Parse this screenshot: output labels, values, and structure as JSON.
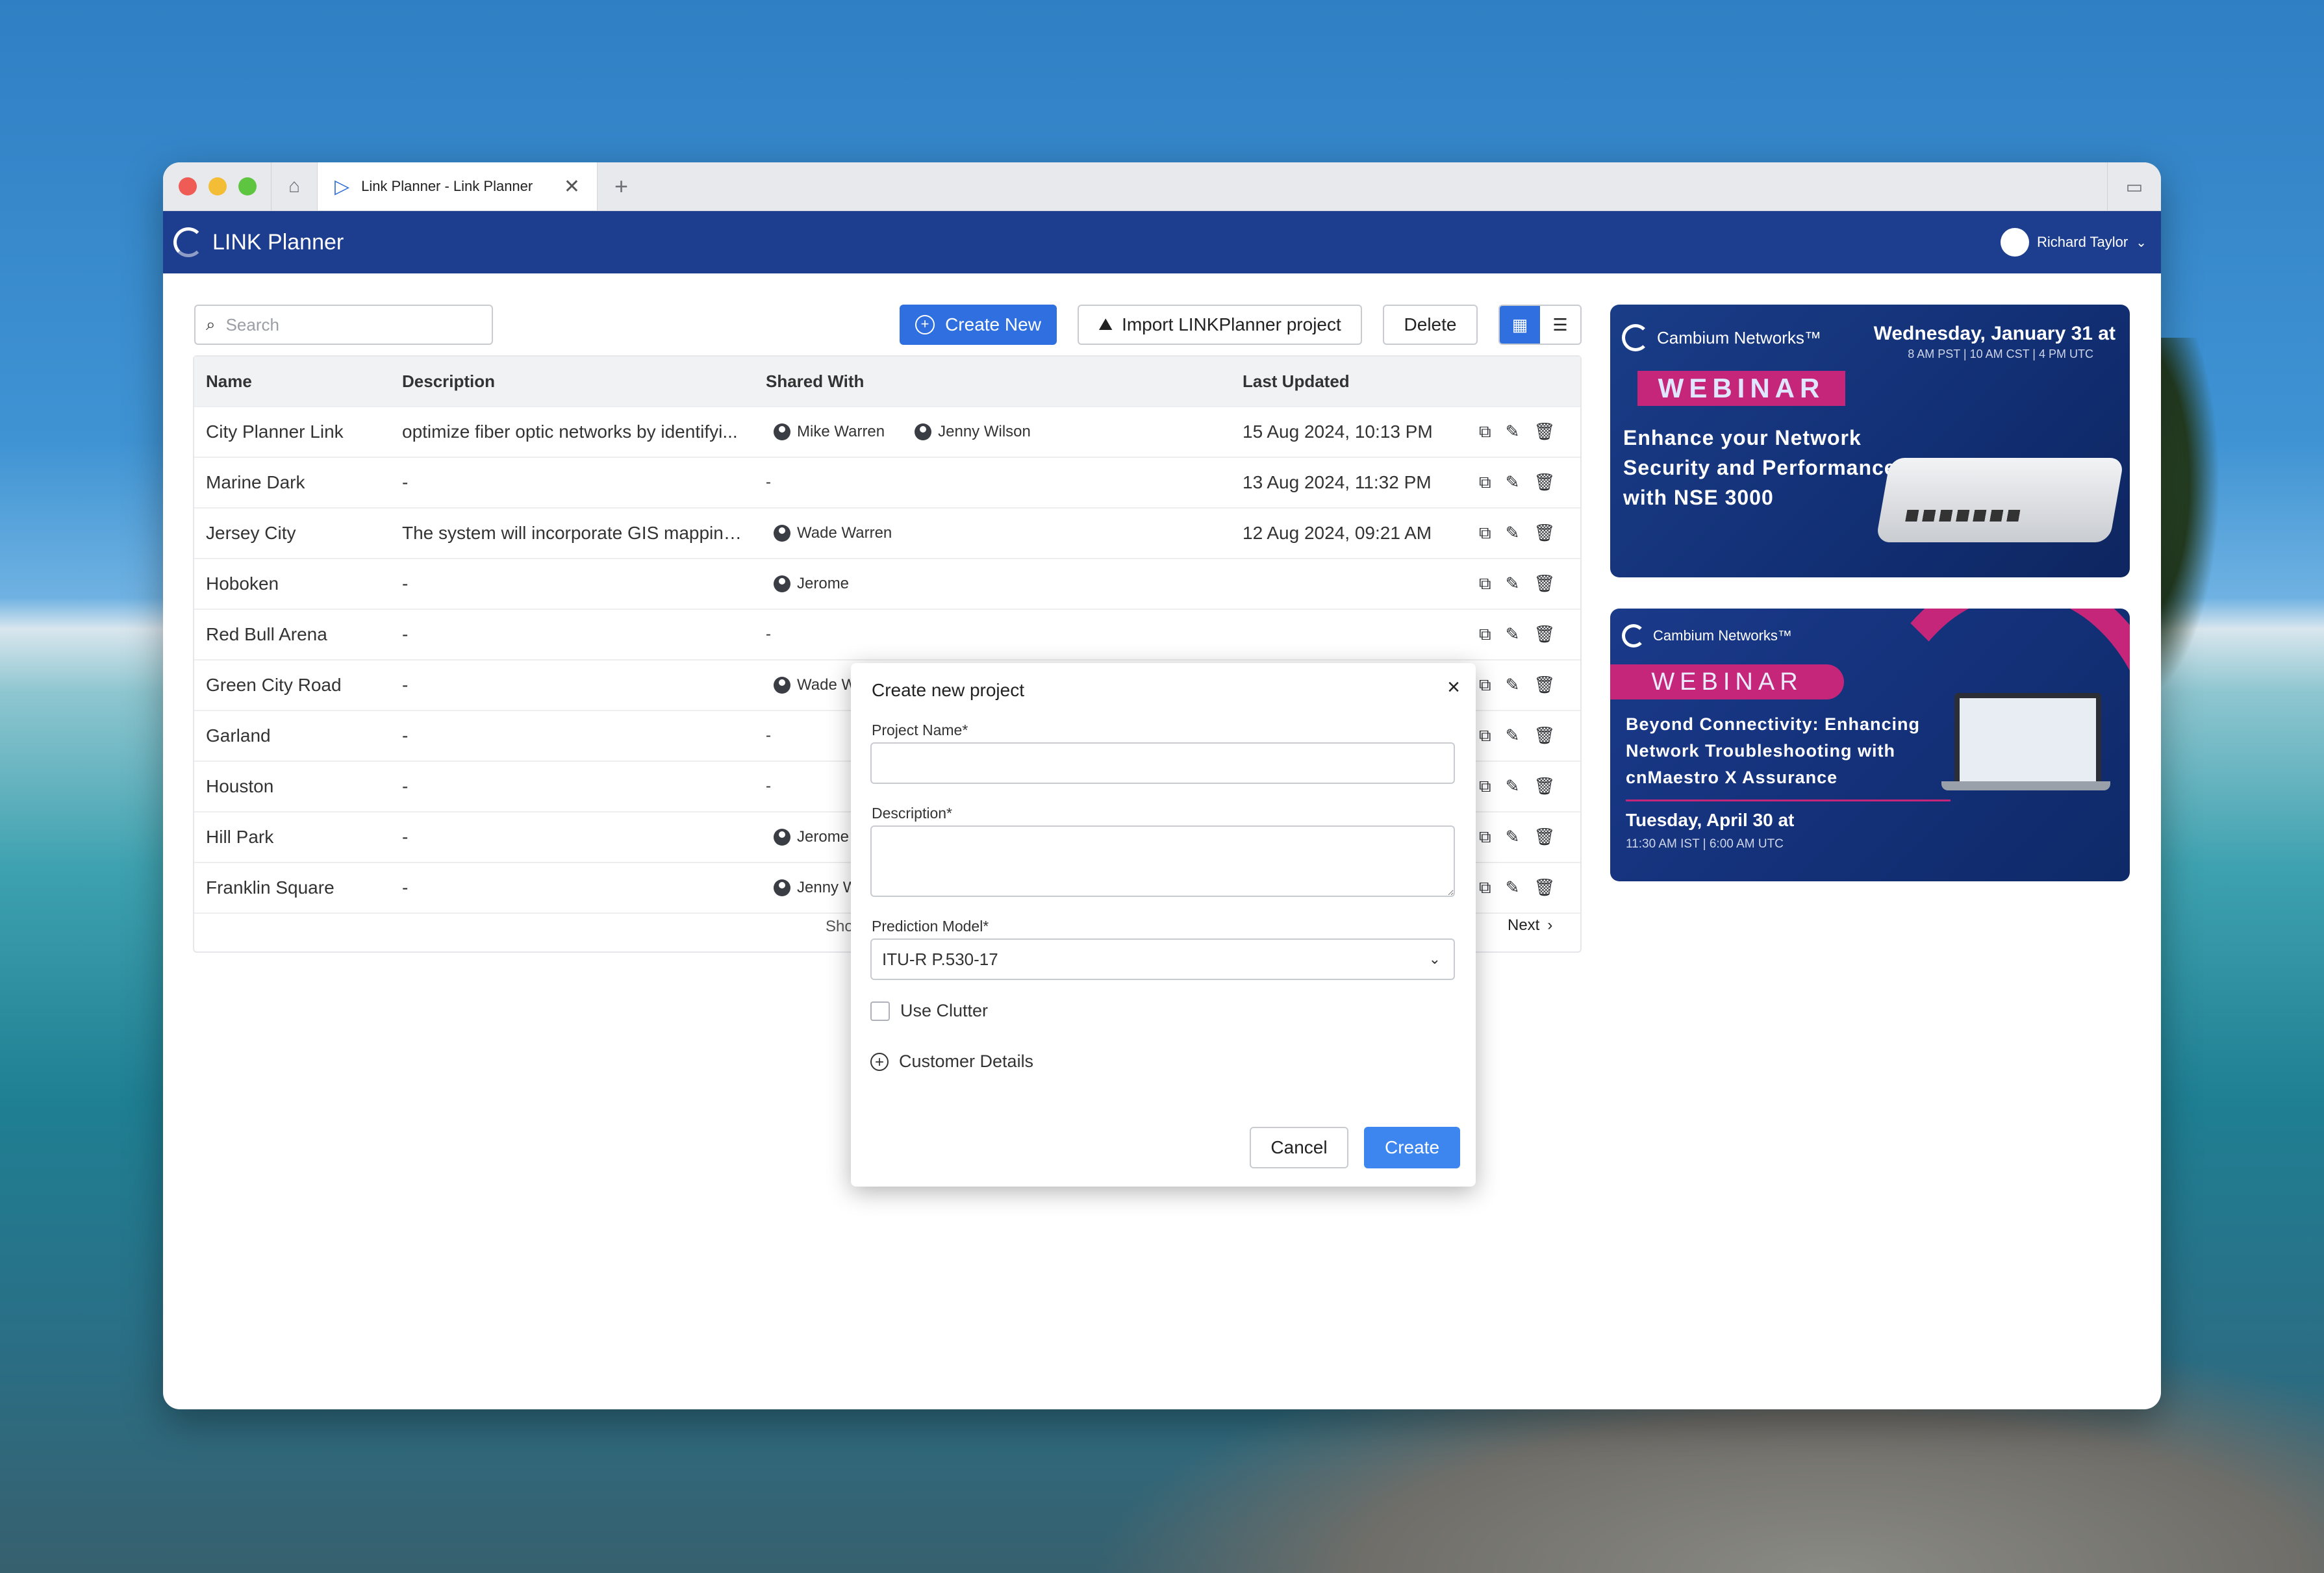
{
  "browser": {
    "tab_title": "Link Planner - Link Planner",
    "home_icon": "home-icon",
    "new_tab_icon": "plus-icon"
  },
  "app": {
    "title": "LINK Planner",
    "user_name": "Richard Taylor"
  },
  "toolbar": {
    "search_placeholder": "Search",
    "create_new_label": "Create New",
    "import_label": "Import LINKPlanner project",
    "delete_label": "Delete"
  },
  "table": {
    "headers": {
      "name": "Name",
      "description": "Description",
      "shared_with": "Shared With",
      "last_updated": "Last Updated"
    },
    "rows": [
      {
        "name": "City Planner Link",
        "description": "optimize fiber optic networks by identifyi...",
        "shared": [
          "Mike Warren",
          "Jenny Wilson"
        ],
        "updated": "15 Aug 2024,  10:13  PM"
      },
      {
        "name": "Marine Dark",
        "description": "-",
        "shared_text": "-",
        "updated": "13 Aug 2024,  11:32  PM"
      },
      {
        "name": "Jersey City",
        "description": "The system will incorporate GIS mapping...",
        "shared": [
          "Wade Warren"
        ],
        "updated": "12 Aug 2024,  09:21  AM"
      },
      {
        "name": "Hoboken",
        "description": "-",
        "shared": [
          "Jerome"
        ],
        "updated": ""
      },
      {
        "name": "Red Bull Arena",
        "description": "-",
        "shared_text": "-",
        "updated": ""
      },
      {
        "name": "Green City Road",
        "description": "-",
        "shared": [
          "Wade W"
        ],
        "updated": ""
      },
      {
        "name": "Garland",
        "description": "-",
        "shared_text": "-",
        "updated": ""
      },
      {
        "name": "Houston",
        "description": "-",
        "shared_text": "-",
        "updated": ""
      },
      {
        "name": "Hill Park",
        "description": "-",
        "shared": [
          "Jerome"
        ],
        "updated": ""
      },
      {
        "name": "Franklin Square",
        "description": "-",
        "shared": [
          "Jenny W"
        ],
        "updated": ""
      }
    ],
    "pager_show": "Sho",
    "pager_next": "Next"
  },
  "banners": [
    {
      "brand": "Cambium Networks™",
      "date": "Wednesday, January 31 at",
      "times": "8 AM PST  |  10 AM CST  |  4 PM UTC",
      "tag": "WEBINAR",
      "headline": "Enhance your Network Security and Performance with NSE 3000"
    },
    {
      "brand": "Cambium Networks™",
      "tag": "WEBINAR",
      "headline": "Beyond Connectivity: Enhancing Network Troubleshooting with cnMaestro X Assurance",
      "date": "Tuesday, April 30 at",
      "times": "11:30 AM IST  |  6:00 AM UTC"
    }
  ],
  "modal": {
    "title": "Create new project",
    "project_name_label": "Project Name*",
    "project_name_value": "",
    "description_label": "Description*",
    "description_value": "",
    "prediction_model_label": "Prediction Model*",
    "prediction_model_value": "ITU-R P.530-17",
    "use_clutter_label": "Use Clutter",
    "use_clutter_checked": false,
    "customer_details_label": "Customer Details",
    "cancel_label": "Cancel",
    "create_label": "Create"
  },
  "colors": {
    "appbar": "#1d3d8f",
    "primary": "#2f6fe0",
    "accent_pink": "#c6267a"
  }
}
